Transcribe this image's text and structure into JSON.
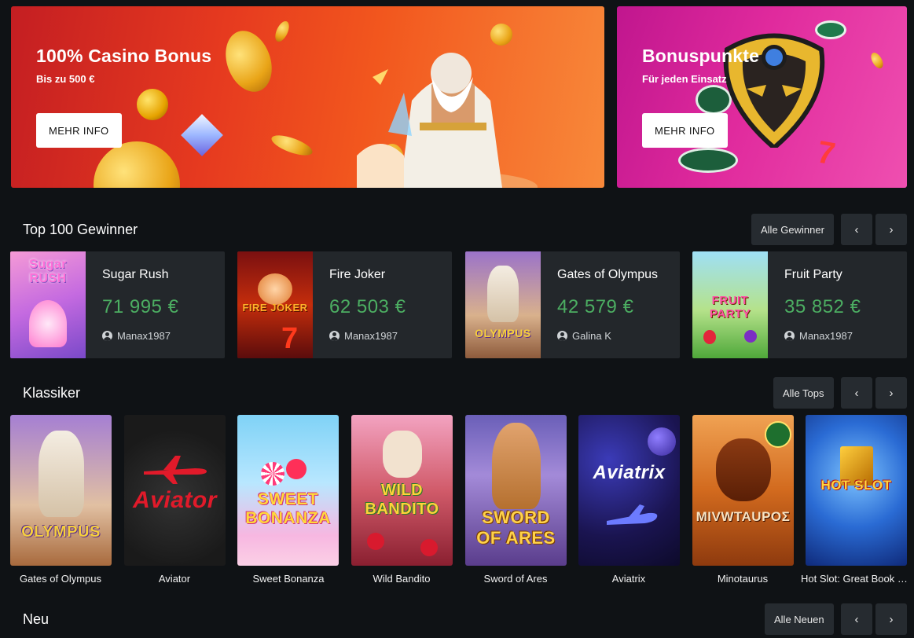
{
  "banners": [
    {
      "title": "100% Casino Bonus",
      "subtitle": "Bis zu 500 €",
      "button": "MEHR INFO"
    },
    {
      "title": "Bonuspunkte",
      "subtitle": "Für jeden Einsatz",
      "button": "MEHR INFO"
    }
  ],
  "top_winners": {
    "title": "Top 100 Gewinner",
    "all_button": "Alle Gewinner",
    "prev": "‹",
    "next": "›",
    "items": [
      {
        "game": "Sugar Rush",
        "amount": "71 995 €",
        "user": "Manax1987",
        "thumb_text": "Sugar RUSH"
      },
      {
        "game": "Fire Joker",
        "amount": "62 503 €",
        "user": "Manax1987",
        "thumb_text": "FIRE JOKER"
      },
      {
        "game": "Gates of Olympus",
        "amount": "42 579 €",
        "user": "Galina K",
        "thumb_text": "OLYMPUS"
      },
      {
        "game": "Fruit Party",
        "amount": "35 852 €",
        "user": "Manax1987",
        "thumb_text": "FRUIT PARTY"
      }
    ]
  },
  "classics": {
    "title": "Klassiker",
    "all_button": "Alle Tops",
    "prev": "‹",
    "next": "›",
    "items": [
      {
        "name": "Gates of Olympus",
        "logo": "OLYMPUS"
      },
      {
        "name": "Aviator",
        "logo": "Aviator"
      },
      {
        "name": "Sweet Bonanza",
        "logo": "SWEET BONANZA"
      },
      {
        "name": "Wild Bandito",
        "logo": "WILD BANDITO"
      },
      {
        "name": "Sword of Ares",
        "logo": "SWORD OF ARES"
      },
      {
        "name": "Aviatrix",
        "logo": "Aviatrix"
      },
      {
        "name": "Minotaurus",
        "logo": "MIVWTAUPOΣ"
      },
      {
        "name": "Hot Slot: Great Book of Magic",
        "logo": "HOT SLOT"
      }
    ]
  },
  "new_section": {
    "title": "Neu",
    "all_button": "Alle Neuen",
    "prev": "‹",
    "next": "›"
  },
  "colors": {
    "background": "#0f1215",
    "card": "#23272b",
    "button": "#262b30",
    "amount_green": "#4cae62",
    "banner_red": "#e63a1f",
    "banner_pink": "#e02a9d"
  }
}
